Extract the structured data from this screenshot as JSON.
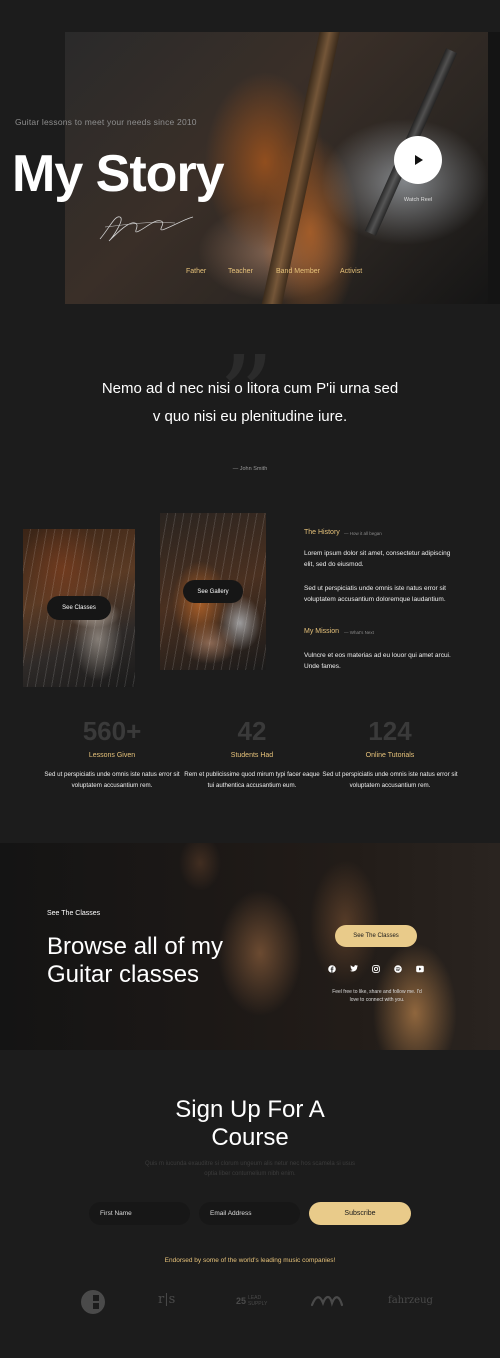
{
  "hero": {
    "subtitle": "Guitar lessons to meet your needs since 2010",
    "title": "My Story",
    "watch_label": "Watch Reel",
    "tags": [
      "Father",
      "Teacher",
      "Band Member",
      "Activist"
    ]
  },
  "quote": {
    "mark": "”",
    "text": "Nemo ad d nec nisi o litora cum P'ii urna sed v quo nisi eu plenitudine iure.",
    "author": "— John Smith"
  },
  "cards": {
    "classes_button": "See Classes",
    "gallery_button": "See Gallery"
  },
  "history": {
    "title": "The History",
    "kicker": "— How it all began",
    "para1": "Lorem ipsum dolor sit amet, consectetur adipiscing elit, sed do eiusmod.",
    "para2": "Sed ut perspiciatis unde omnis iste natus error sit voluptatem accusantium doloremque laudantium."
  },
  "mission": {
    "title": "My Mission",
    "kicker": "— What's Next",
    "para": "Vulncre et eos materias ad eu louor qui amet arcui. Unde fames."
  },
  "stats": [
    {
      "num": "560+",
      "label": "Lessons Given",
      "text": "Sed ut perspiciatis unde omnis iste natus error sit voluptatem accusantium rem."
    },
    {
      "num": "42",
      "label": "Students Had",
      "text": "Rem et publicissime quod mirum typi facer eaque tui authentica accusantium eum."
    },
    {
      "num": "124",
      "label": "Online Tutorials",
      "text": "Sed ut perspiciatis unde omnis iste natus error sit voluptatem accusantium rem."
    }
  ],
  "browse": {
    "kicker": "See The Classes",
    "title": "Browse all of my Guitar classes",
    "button": "See The Classes",
    "social_icons": [
      "facebook-icon",
      "twitter-icon",
      "instagram-icon",
      "spotify-icon",
      "youtube-icon"
    ],
    "social_note": "Feel free to like, share and follow me. I'd love to connect with you."
  },
  "signup": {
    "title": "Sign Up For A Course",
    "subtitle": "Quis m iucunda exauditre si clorum ungeum alis netur nec hos scamela si usus optia liber conturnelium nibh enim.",
    "first_name_placeholder": "First Name",
    "email_placeholder": "Email Address",
    "subscribe_label": "Subscribe",
    "endorse": "Endorsed by some of the world's leading music companies!"
  },
  "logos": {
    "logo2": "r|s",
    "logo3_line1": "LEAD",
    "logo3_line2": "SUPPLY",
    "logo5": "fahrzeug"
  },
  "colors": {
    "accent": "#e6c27a",
    "button": "#e9cb8a",
    "background": "#1c1c1c"
  }
}
